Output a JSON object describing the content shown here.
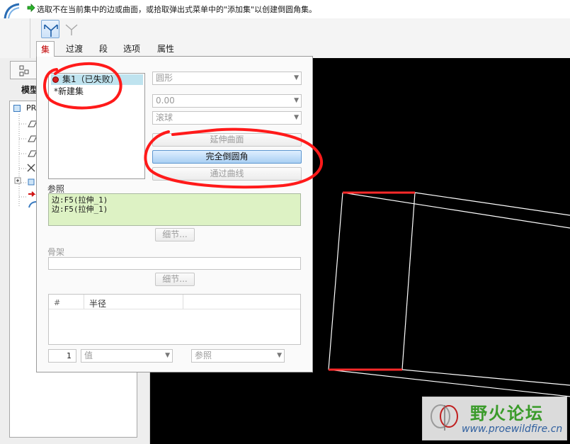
{
  "message": {
    "text": "选取不在当前集中的边或曲面，或拾取弹出式菜单中的\"添加集\"以创建倒圆角集。"
  },
  "tabs": [
    "集",
    "过渡",
    "段",
    "选项",
    "属性"
  ],
  "model_tree": {
    "header": "模型",
    "root_label": "PR"
  },
  "sets": {
    "set1": "集1（已失败）",
    "new_set": "*新建集"
  },
  "shape": {
    "value": "圆形"
  },
  "radius_value": {
    "value": "0.00"
  },
  "method": {
    "value": "滚球"
  },
  "buttons": {
    "extend": "延伸曲面",
    "full_round": "完全倒圆角",
    "through_curve": "通过曲线",
    "detail": "细节..."
  },
  "references": {
    "label": "参照",
    "items": [
      "边:F5(拉伸_1)",
      "边:F5(拉伸_1)"
    ]
  },
  "frame": {
    "label": "骨架"
  },
  "radius_table": {
    "col_hash": "#",
    "col_radius": "半径"
  },
  "row": {
    "number": "1",
    "value_combo": "值",
    "ref_combo": "参照"
  },
  "watermark": {
    "name": "野火论坛",
    "url": "www.proewildfire.cn"
  },
  "colors": {
    "annotation": "#ff1a1a",
    "reference_bg": "#ddf2c4",
    "graphics_bg": "#000000",
    "selected_edge": "#ff2a2a"
  }
}
